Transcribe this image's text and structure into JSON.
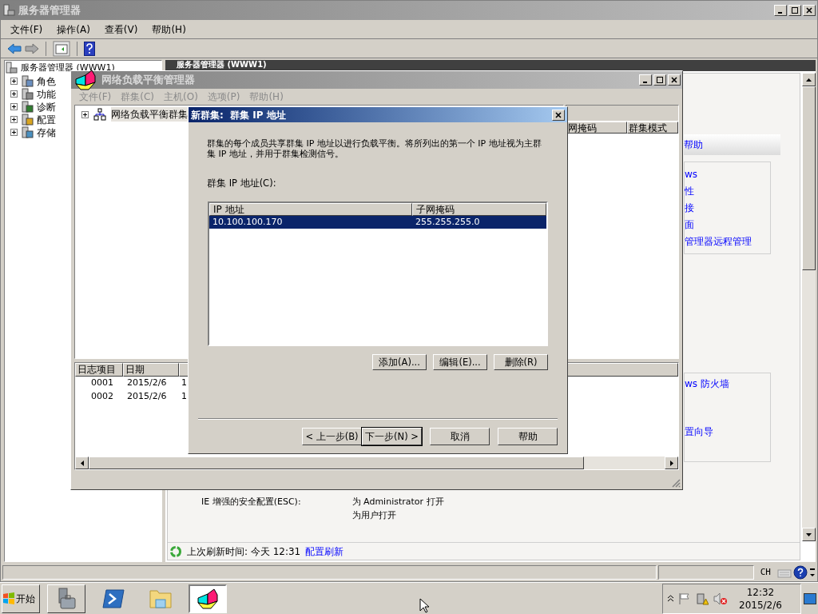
{
  "main_window": {
    "title": "服务器管理器",
    "menu": [
      "文件(F)",
      "操作(A)",
      "查看(V)",
      "帮助(H)"
    ],
    "tree": {
      "label": "服务器管理器 (WWW1)",
      "children": [
        {
          "label": "角色",
          "kind": "roles",
          "expanded": false
        },
        {
          "label": "功能",
          "kind": "features",
          "expanded": false
        },
        {
          "label": "诊断",
          "kind": "diagnostics",
          "expanded": false
        },
        {
          "label": "配置",
          "kind": "configuration",
          "expanded": false
        },
        {
          "label": "存储",
          "kind": "storage",
          "expanded": false
        }
      ]
    },
    "pane_title": "服务器管理器 (WWW1)",
    "help_header": "帮助",
    "links_top": [
      "ws",
      "性",
      "接",
      "面",
      "管理器远程管理"
    ],
    "links_bottom": [
      "ws 防火墙",
      "置向导"
    ],
    "esc": {
      "label": "IE 增强的安全配置(ESC):",
      "values": [
        "为 Administrator 打开",
        "为用户打开"
      ]
    },
    "refresh": {
      "text": "上次刷新时间: 今天 12:31",
      "link": "配置刷新"
    },
    "status_bar": {
      "language": "CH"
    }
  },
  "nlb_window": {
    "title": "网络负载平衡管理器",
    "menu": [
      {
        "label": "文件(F)",
        "disabled": true
      },
      {
        "label": "群集(C)",
        "disabled": true
      },
      {
        "label": "主机(O)",
        "disabled": true
      },
      {
        "label": "选项(P)",
        "disabled": true
      },
      {
        "label": "帮助(H)",
        "disabled": true
      }
    ],
    "tree": {
      "label": "网络负载平衡群集",
      "expanded": false
    },
    "list_columns": [
      "网掩码",
      "群集模式"
    ],
    "log": {
      "columns": [
        "日志项目",
        "日期"
      ],
      "rows": [
        [
          "0001",
          "2015/2/6",
          "1"
        ],
        [
          "0002",
          "2015/2/6",
          "1"
        ]
      ]
    }
  },
  "dialog": {
    "title": "新群集:  群集 IP 地址",
    "description": "群集的每个成员共享群集 IP 地址以进行负载平衡。将所列出的第一个 IP 地址视为主群集 IP 地址，并用于群集检测信号。",
    "list_label": "群集 IP 地址(C):",
    "columns": [
      "IP 地址",
      "子网掩码"
    ],
    "rows": [
      {
        "ip": "10.100.100.170",
        "mask": "255.255.255.0",
        "selected": true
      }
    ],
    "list_buttons": [
      "添加(A)...",
      "编辑(E)...",
      "删除(R)"
    ],
    "nav_buttons": [
      {
        "label": "< 上一步(B)",
        "default": false
      },
      {
        "label": "下一步(N) >",
        "default": true
      },
      {
        "label": "取消",
        "default": false
      },
      {
        "label": "帮助",
        "default": false
      }
    ]
  },
  "taskbar": {
    "start": "开始",
    "apps": [
      {
        "kind": "server",
        "selected": false
      },
      {
        "kind": "shell",
        "selected": false
      },
      {
        "kind": "folder",
        "selected": false
      },
      {
        "kind": "nlb",
        "selected": true
      }
    ],
    "clock": {
      "time": "12:32",
      "date": "2015/2/6"
    }
  }
}
